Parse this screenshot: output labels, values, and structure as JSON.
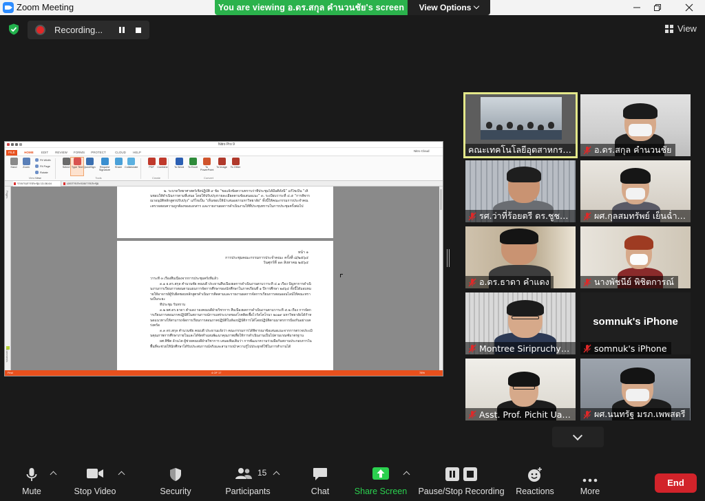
{
  "window": {
    "title": "Zoom Meeting",
    "banner": "You are viewing อ.ดร.สกุล คำนวนชัย's screen",
    "view_options": "View Options",
    "controls": [
      "minimize",
      "restore",
      "close"
    ]
  },
  "meeting_bar": {
    "recording_label": "Recording...",
    "view_label": "View"
  },
  "shared_app": {
    "title": "Nitro Pro 9",
    "cloud_label": "Nitro Cloud",
    "ribbon_tabs": [
      "FILE",
      "HOME",
      "EDIT",
      "REVIEW",
      "FORMS",
      "PROTECT",
      "CLOUD",
      "HELP"
    ],
    "ribbon_buttons": [
      {
        "label": "Hand",
        "color": "#8a8a8a"
      },
      {
        "label": "Zoom",
        "color": "#5a7fb8"
      },
      {
        "label": "Select",
        "color": "#6b6b6b"
      },
      {
        "label": "Type Text",
        "color": "#d9534f",
        "active": true
      },
      {
        "label": "QuickSign",
        "color": "#3a6fb0"
      },
      {
        "label": "Request Signature",
        "color": "#3a8fd0"
      },
      {
        "label": "Share",
        "color": "#4aa0d8"
      },
      {
        "label": "Collaborate",
        "color": "#5ab0e0"
      },
      {
        "label": "PDF",
        "color": "#c0392b"
      },
      {
        "label": "Combine",
        "color": "#c0392b"
      },
      {
        "label": "To Word",
        "color": "#2b5fb3"
      },
      {
        "label": "To Excel",
        "color": "#2e8b3a"
      },
      {
        "label": "To PowerPoint",
        "color": "#d0542c"
      },
      {
        "label": "To Image",
        "color": "#b0392b"
      },
      {
        "label": "To Other",
        "color": "#b0392b"
      }
    ],
    "small_buttons": [
      "Fit Width",
      "Fit Page",
      "Rotate View"
    ],
    "groups": [
      "View",
      "Tools",
      "Create",
      "Convert"
    ],
    "doc_tabs": [
      "รายงานการประชุม 13-08-64",
      "เอกสารประกอบการประชุม"
    ],
    "page1_lines": "๒. ระบาดวิทยาศาสตร์เชิงปฏิบัติ ๙ ข้อ “ขอแจ้งข้อความทราบว่าที่ประชุมได้มีมติดังนี้” แก้ไขเป็น “เห็นชอบให้ดำเนินการตามที่เสนอ โดยให้ปรับปรุงรายละเอียดตามข้อเสนอแนะ” ๓. ระเบียบวาระที่ ๔.๕ “การพิจารณาอนุมัติหลักสูตรปรับปรุง” แก้ไขเป็น “เห็นชอบให้นำเสนอสภามหาวิทยาลัย” ทั้งนี้ให้คณะกรรมการประจำคณะตรวจสอบความถูกต้องของเอกสาร และรายงานผลการดำเนินงานให้ที่ประชุมทราบในการประชุมครั้งต่อไป",
    "page2_header": [
      "หน้า ๑",
      "การประชุมคณะกรรมการประจำคณะ ครั้งที่ ๘/๒๕๖๔",
      "วันศุกร์ที่ ๑๓ สิงหาคม ๒๕๖๔"
    ],
    "page2_paragraphs": [
      "วาระที่ ๓ เรื่องสืบเนื่องจากการประชุมครั้งที่แล้ว",
      "๓.๑ อ.ดร.สกุล คำนวนชัย คณบดี ประธานสืบเนื่องผลการดำเนินงานตามวาระที่ ๔.๑ เรื่อง ปัญหาการดำเนินงานการเรียนการสอนตามแผนการจัดการศึกษาของนักศึกษาในภาคเรียนที่ ๑ ปีการศึกษา ๒๕๖๔ ทั้งนี้ได้มอบหมายให้อาจารย์ผู้รับผิดชอบหลักสูตรดำเนินการติดตามและรายงานผลการจัดการเรียนการสอนออนไลน์ให้คณะทราบเป็นระยะ",
      "ที่ประชุม รับทราบ",
      "๓.๒ ผศ.ดร.ธาดา คำแดง รองคณบดีฝ่ายวิชาการ สืบเนื่องผลการดำเนินงานตามวาระที่ ๕.๒ เรื่อง การจัดการเรียนการสอนภาคปฏิบัติในสถานการณ์การแพร่ระบาดของโรคติดเชื้อไวรัสโคโรนา ๒๐๑๙ มหาวิทยาลัยได้กำหนดแนวทางให้สามารถจัดการเรียนการสอนภาคปฏิบัติในห้องปฏิบัติการได้โดยปฏิบัติตามมาตรการป้องกันอย่างเคร่งครัด",
      "๓.๓ ดร.สกุล คำนวนชัย คณบดี ประธานแจ้งว่า คณะกรรมการได้พิจารณาข้อเสนอแนะจากการตรวจประเมินคุณภาพการศึกษาภายในและได้จัดทำแผนพัฒนาคุณภาพเพื่อให้การดำเนินงานเป็นไปตามเกณฑ์มาตรฐาน",
      "ผศ.พิชิต อ้วนโต ผู้ช่วยคณบดีฝ่ายวิชาการ เสนอเพิ่มเติมว่า การพัฒนาความร่วมมือกับสถานประกอบการในพื้นที่จะช่วยให้นักศึกษาได้รับประสบการณ์จริงและสามารถนำความรู้ไปประยุกต์ใช้ในการทำงานได้"
    ],
    "status_left": "Find",
    "status_page": "4 OF 17",
    "status_zoom": "78%"
  },
  "participants": [
    {
      "name": "คณะเทคโนโลยีอุตสาหกรรม",
      "muted": false,
      "speaker": true,
      "scene": "room"
    },
    {
      "name": "อ.ดร.สกุล คำนวนชัย",
      "muted": true,
      "scene": "man-mask"
    },
    {
      "name": "รศ.ว่าที่ร้อยตรี ดร.ชูชาติ …",
      "muted": true,
      "scene": "man-down"
    },
    {
      "name": "ผศ.กุลสมทรัพย์ เย็นฉ่ำช…",
      "muted": true,
      "scene": "woman-mask"
    },
    {
      "name": "อ.ดร.ธาดา คำแดง",
      "muted": true,
      "scene": "man-down-2"
    },
    {
      "name": "นางพัชนีย์ พิชิตการณ์",
      "muted": true,
      "scene": "woman-red"
    },
    {
      "name": "Montree Siripruchyan…",
      "muted": true,
      "scene": "man-glasses"
    },
    {
      "name": "somnuk's iPhone",
      "muted": true,
      "scene": "none",
      "title": "somnuk's iPhone"
    },
    {
      "name": "Asst. Prof. Pichit Uant…",
      "muted": true,
      "scene": "man-glasses-2"
    },
    {
      "name": "ผศ.นนทรัฐ มรภ.เพพสตรี",
      "muted": true,
      "scene": "man-mask-2"
    }
  ],
  "toolbar": {
    "buttons": [
      {
        "key": "mute",
        "label": "Mute",
        "caret": true
      },
      {
        "key": "video",
        "label": "Stop Video",
        "caret": true
      },
      {
        "key": "security",
        "label": "Security"
      },
      {
        "key": "participants",
        "label": "Participants",
        "count": "15",
        "caret": true
      },
      {
        "key": "chat",
        "label": "Chat"
      },
      {
        "key": "share",
        "label": "Share Screen",
        "caret": true,
        "green": true
      },
      {
        "key": "record",
        "label": "Pause/Stop Recording"
      },
      {
        "key": "reactions",
        "label": "Reactions"
      },
      {
        "key": "more",
        "label": "More"
      }
    ],
    "end_label": "End"
  },
  "colors": {
    "accent_green": "#2bb24c",
    "end_red": "#d2232a",
    "speaker_border": "#e4e88a",
    "nitro_orange": "#e8501d"
  }
}
